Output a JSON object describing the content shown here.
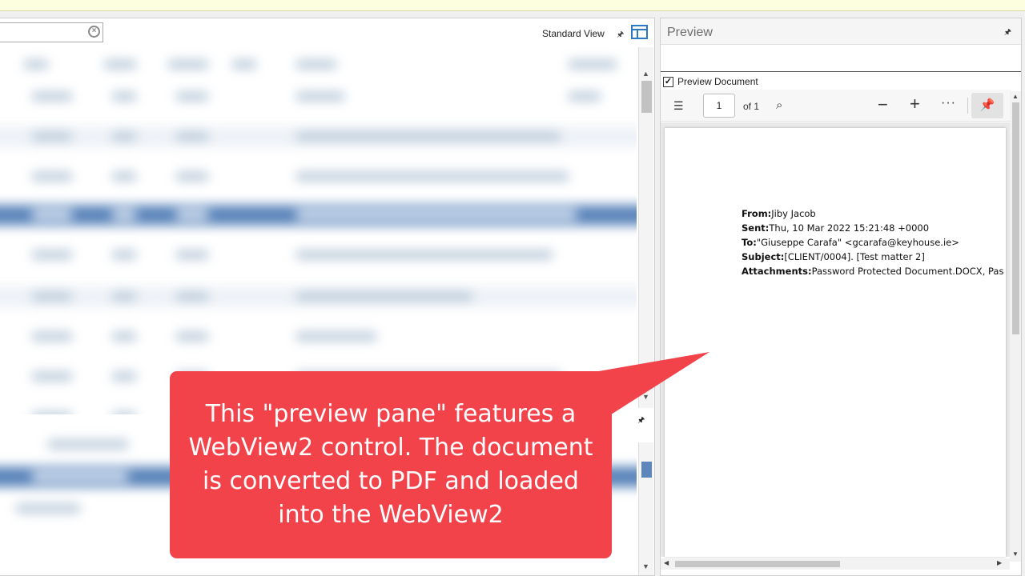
{
  "left_pane": {
    "view_label": "Standard View"
  },
  "preview": {
    "title": "Preview",
    "checkbox_label": "Preview Document",
    "checkbox_checked": true,
    "toolbar": {
      "page_number": "1",
      "page_of": "of 1"
    },
    "email": {
      "from_label": "From:",
      "from_value": "Jiby Jacob",
      "sent_label": "Sent:",
      "sent_value": "Thu, 10 Mar 2022 15:21:48 +0000",
      "to_label": "To:",
      "to_value": "\"Giuseppe Carafa\" <gcarafa@keyhouse.ie>",
      "subject_label": "Subject:",
      "subject_value": "[CLIENT/0004]. [Test matter 2]",
      "attachments_label": "Attachments:",
      "attachments_value": "Password Protected Document.DOCX, Pas"
    }
  },
  "callout": {
    "text": "This \"preview pane\" features a WebView2 control. The document is converted to PDF and loaded into the WebView2",
    "color": "#f2434b"
  },
  "colors": {
    "selection": "#5d86bb",
    "accent": "#2b79c2"
  },
  "icons": {
    "clear": "clear-search-icon",
    "pin": "pin-icon",
    "layout": "layout-icon",
    "toc": "table-of-contents-icon",
    "search": "search-icon",
    "zoom_out": "minus-icon",
    "zoom_in": "plus-icon",
    "more": "more-options-icon",
    "keep_toolbar": "pushpin-icon"
  }
}
